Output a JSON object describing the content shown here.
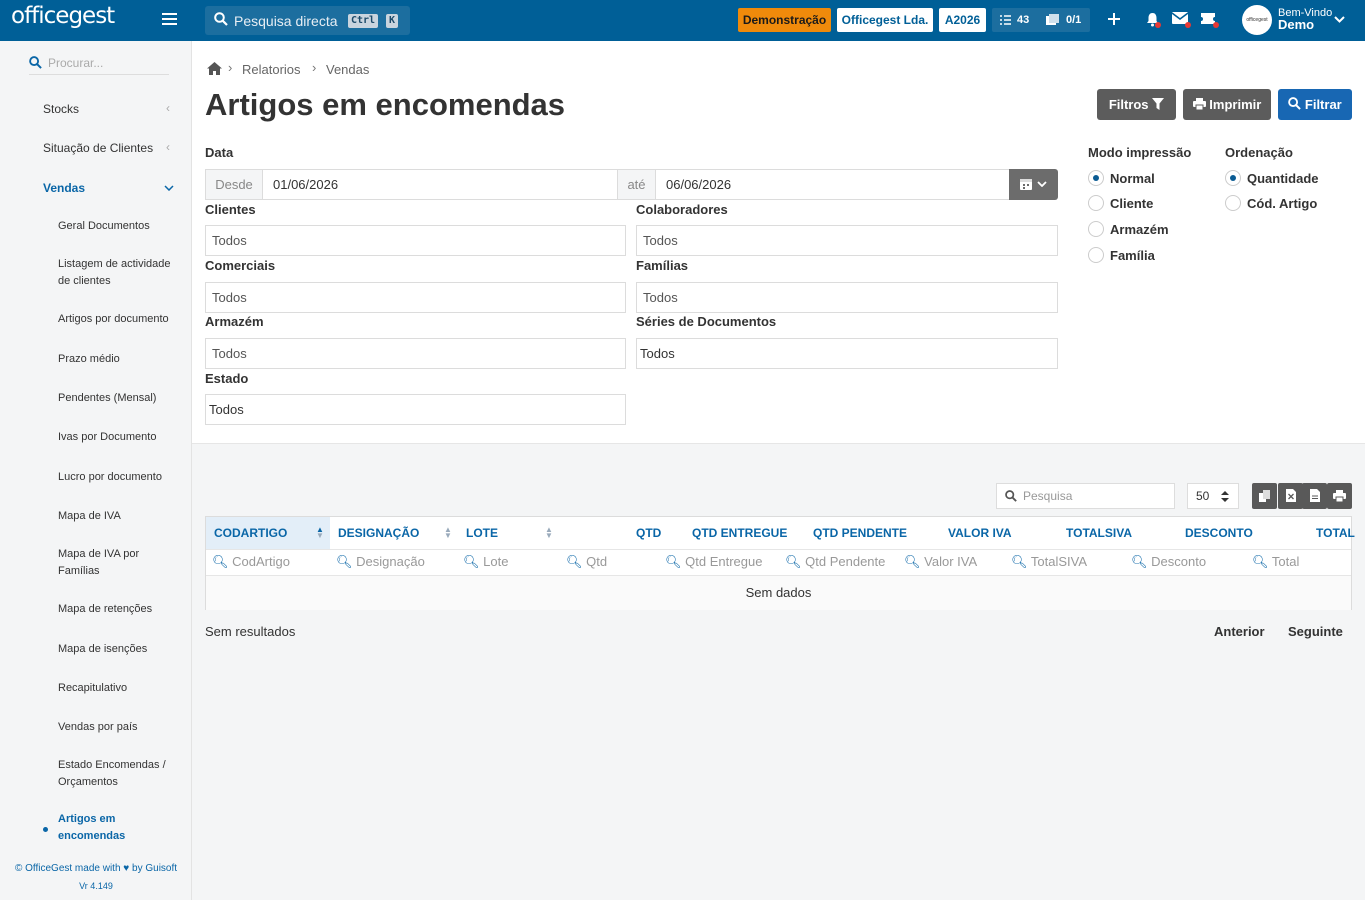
{
  "topbar": {
    "logo": "officegest",
    "search_placeholder": "Pesquisa directa",
    "shortcut_keys": [
      "Ctrl",
      "K"
    ],
    "demo_badge": "Demonstração",
    "company": "Officegest Lda.",
    "year": "A2026",
    "tasks_count": "43",
    "docs_count": "0/1",
    "welcome": "Bem-Vindo",
    "user": "Demo",
    "avatar_text": "officegest",
    "accent_color": "#005f97"
  },
  "sidebar": {
    "search_placeholder": "Procurar...",
    "items": [
      {
        "label": "Stocks"
      },
      {
        "label": "Situação de Clientes"
      },
      {
        "label": "Vendas"
      }
    ],
    "subitems": [
      {
        "label": "Geral Documentos"
      },
      {
        "label": "Listagem de actividade de clientes"
      },
      {
        "label": "Artigos por documento"
      },
      {
        "label": "Prazo médio"
      },
      {
        "label": "Pendentes (Mensal)"
      },
      {
        "label": "Ivas por Documento"
      },
      {
        "label": "Lucro por documento"
      },
      {
        "label": "Mapa de IVA"
      },
      {
        "label": "Mapa de IVA por Famílias"
      },
      {
        "label": "Mapa de retenções"
      },
      {
        "label": "Mapa de isenções"
      },
      {
        "label": "Recapitulativo"
      },
      {
        "label": "Vendas por país"
      },
      {
        "label": "Estado Encomendas / Orçamentos"
      },
      {
        "label": "Artigos em encomendas"
      }
    ],
    "footer_left": "© OfficeGest made with",
    "footer_right": "by Guisoft",
    "version": "Vr 4.149"
  },
  "breadcrumb": [
    "Relatorios",
    "Vendas"
  ],
  "page_title": "Artigos em encomendas",
  "actions": {
    "filters": "Filtros",
    "print": "Imprimir",
    "filter": "Filtrar"
  },
  "form": {
    "date_label": "Data",
    "from_label": "Desde",
    "from_value": "01/06/2026",
    "to_label": "até",
    "to_value": "06/06/2026",
    "clients_label": "Clientes",
    "clients_value": "Todos",
    "collaborators_label": "Colaboradores",
    "collaborators_value": "Todos",
    "commercials_label": "Comerciais",
    "commercials_value": "Todos",
    "families_label": "Famílias",
    "families_value": "Todos",
    "warehouse_label": "Armazém",
    "warehouse_value": "Todos",
    "series_label": "Séries de Documentos",
    "series_value": "Todos",
    "state_label": "Estado",
    "state_value": "Todos"
  },
  "print_mode": {
    "label": "Modo impressão",
    "options": [
      {
        "label": "Normal",
        "selected": true
      },
      {
        "label": "Cliente",
        "selected": false
      },
      {
        "label": "Armazém",
        "selected": false
      },
      {
        "label": "Família",
        "selected": false
      }
    ]
  },
  "ordering": {
    "label": "Ordenação",
    "options": [
      {
        "label": "Quantidade",
        "selected": true
      },
      {
        "label": "Cód. Artigo",
        "selected": false
      }
    ]
  },
  "table": {
    "search_placeholder": "Pesquisa",
    "page_size": "50",
    "columns": [
      "CODARTIGO",
      "DESIGNAÇÃO",
      "LOTE",
      "QTD",
      "QTD ENTREGUE",
      "QTD PENDENTE",
      "VALOR IVA",
      "TOTALSIVA",
      "DESCONTO",
      "TOTAL"
    ],
    "filters": [
      "CodArtigo",
      "Designação",
      "Lote",
      "Qtd",
      "Qtd Entregue",
      "Qtd Pendente",
      "Valor IVA",
      "TotalSIVA",
      "Desconto",
      "Total"
    ],
    "empty": "Sem dados",
    "results": "Sem resultados",
    "prev": "Anterior",
    "next": "Seguinte"
  }
}
